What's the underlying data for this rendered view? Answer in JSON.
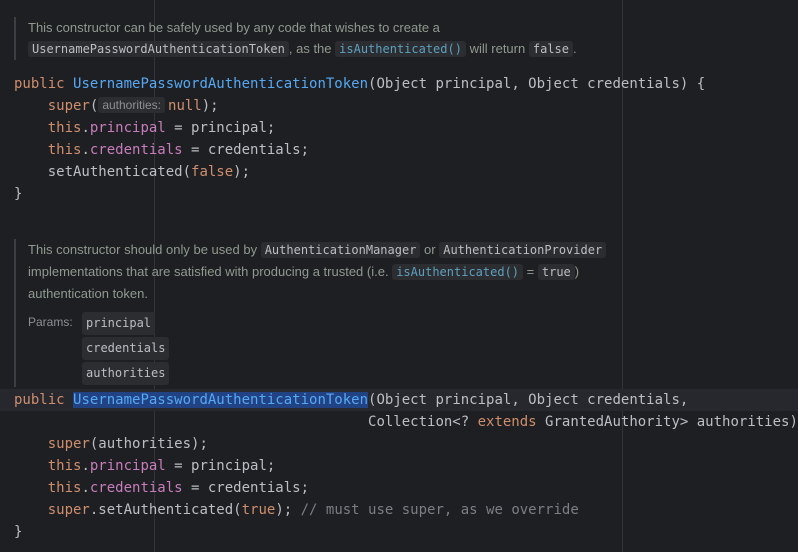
{
  "doc1": {
    "t1": "This constructor can be safely used by any code that wishes to create a",
    "c1": "UsernamePasswordAuthenticationToken",
    "t2": ", as the",
    "c2": "isAuthenticated()",
    "t3": "will return",
    "c3": "false",
    "t4": "."
  },
  "code1": {
    "l1_kw": "public",
    "l1_fn": "UsernamePasswordAuthenticationToken",
    "l1_rest": "(Object principal, Object credentials) {",
    "l2_kw": "super",
    "l2_open": "(",
    "l2_hint": "authorities:",
    "l2_kw2": "null",
    "l2_close": ");",
    "l3_kw": "this",
    "l3_fld": "principal",
    "l3_rest": " = principal;",
    "l4_kw": "this",
    "l4_fld": "credentials",
    "l4_rest": " = credentials;",
    "l5_a": "setAuthenticated(",
    "l5_kw": "false",
    "l5_b": ");",
    "l6": "}"
  },
  "doc2": {
    "t1": "This constructor should only be used by",
    "c1": "AuthenticationManager",
    "t2": "or",
    "c2": "AuthenticationProvider",
    "t3": "implementations that are satisfied with producing a trusted (i.e.",
    "c3": "isAuthenticated()",
    "t4": "=",
    "c4": "true",
    "t5": ")",
    "t6": "authentication token.",
    "params_label": "Params:",
    "params": [
      "principal",
      "credentials",
      "authorities"
    ]
  },
  "code2": {
    "l1_kw": "public",
    "l1_fn": "UsernamePasswordAuthenticationToken",
    "l1_rest": "(Object principal, Object credentials,",
    "l2_a": "Collection<? ",
    "l2_kw": "extends",
    "l2_b": " GrantedAuthority> authorities) {",
    "l3_kw": "super",
    "l3_rest": "(authorities);",
    "l4_kw": "this",
    "l4_fld": "principal",
    "l4_rest": " = principal;",
    "l5_kw": "this",
    "l5_fld": "credentials",
    "l5_rest": " = credentials;",
    "l6_kw": "super",
    "l6_a": ".setAuthenticated(",
    "l6_kw2": "true",
    "l6_b": "); ",
    "l6_cm": "// must use super, as we override",
    "l7": "}"
  }
}
